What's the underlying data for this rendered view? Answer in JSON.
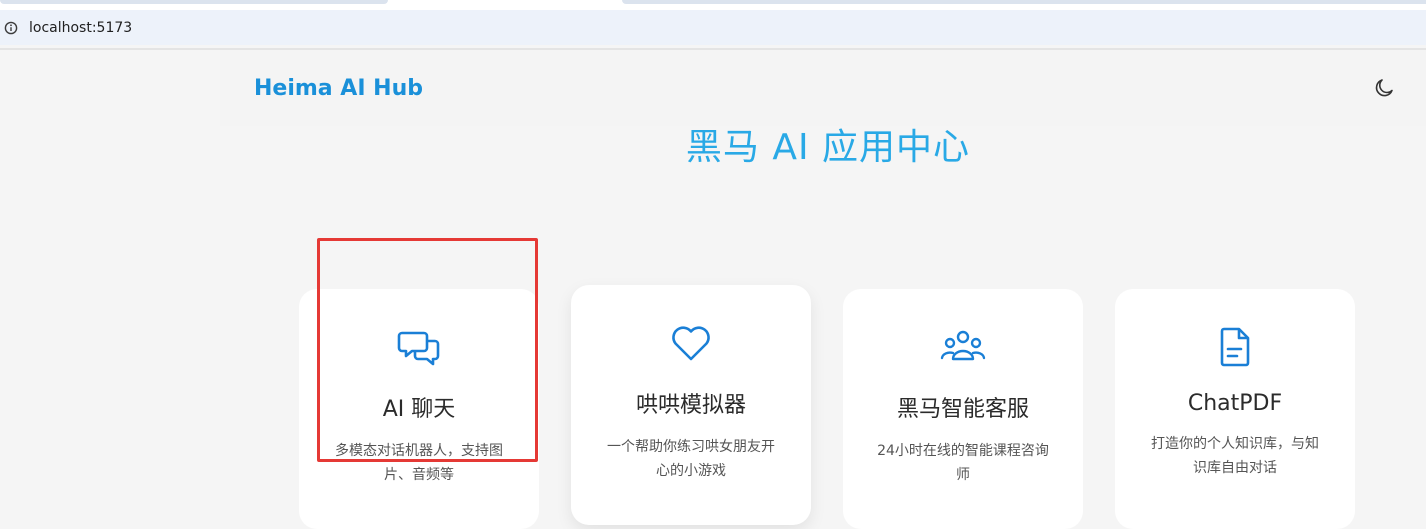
{
  "browser": {
    "url": "localhost:5173"
  },
  "header": {
    "logo": "Heima AI Hub"
  },
  "main": {
    "title": "黑马 AI 应用中心"
  },
  "cards": [
    {
      "title": "AI 聊天",
      "desc": "多模态对话机器人，支持图片、音频等",
      "icon": "chat-bubbles-icon"
    },
    {
      "title": "哄哄模拟器",
      "desc": "一个帮助你练习哄女朋友开心的小游戏",
      "icon": "heart-icon"
    },
    {
      "title": "黑马智能客服",
      "desc": "24小时在线的智能课程咨询师",
      "icon": "users-group-icon"
    },
    {
      "title": "ChatPDF",
      "desc": "打造你的个人知识库，与知识库自由对话",
      "icon": "document-icon"
    }
  ],
  "colors": {
    "accent": "#1a90d9",
    "title": "#29a9e6",
    "highlight": "#e53935"
  }
}
